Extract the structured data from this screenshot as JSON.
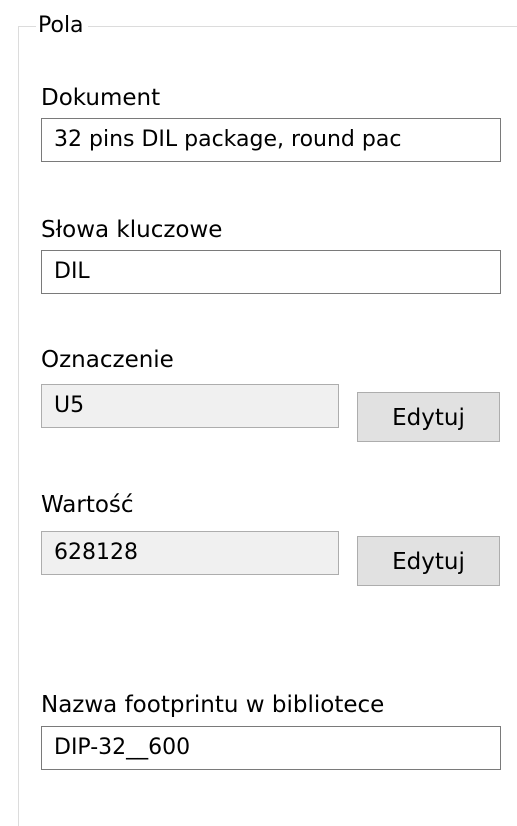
{
  "group": {
    "title": "Pola"
  },
  "fields": {
    "dokument": {
      "label": "Dokument",
      "value": "32 pins DIL package, round paс"
    },
    "slowa_kluczowe": {
      "label": "Słowa kluczowe",
      "value": "DIL"
    },
    "oznaczenie": {
      "label": "Oznaczenie",
      "value": "U5",
      "button_label": "Edytuj"
    },
    "wartosc": {
      "label": "Wartość",
      "value": "628128",
      "button_label": "Edytuj"
    },
    "nazwa_footprintu": {
      "label": "Nazwa footprintu w bibliotece",
      "value": "DIP-32__600"
    }
  }
}
